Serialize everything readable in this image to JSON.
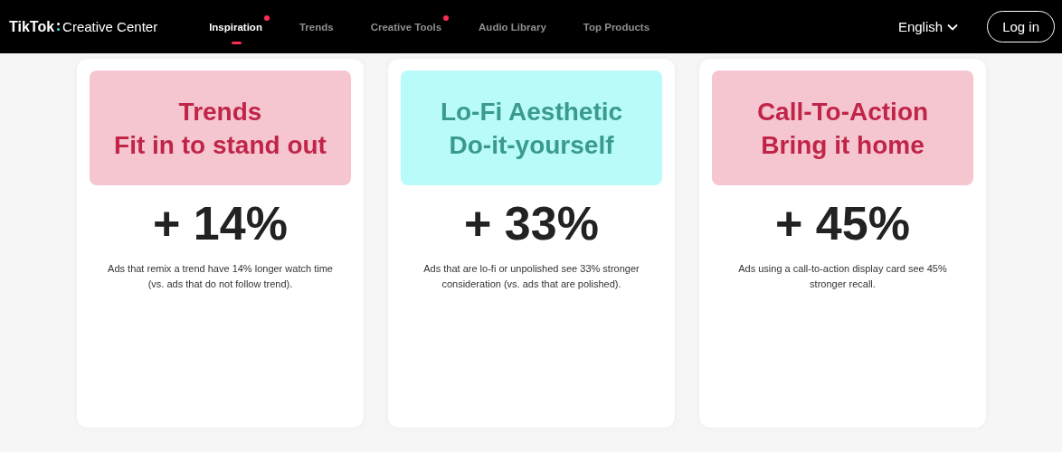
{
  "header": {
    "logo": {
      "brand": "TikTok",
      "product": "Creative Center"
    },
    "nav": [
      {
        "label": "Inspiration",
        "selected": true,
        "dot": true
      },
      {
        "label": "Trends",
        "selected": false,
        "dot": false
      },
      {
        "label": "Creative Tools",
        "selected": false,
        "dot": true
      },
      {
        "label": "Audio Library",
        "selected": false,
        "dot": false
      },
      {
        "label": "Top Products",
        "selected": false,
        "dot": false
      }
    ],
    "language": "English",
    "login": "Log in"
  },
  "cards": [
    {
      "kind": "pink",
      "title": "Trends",
      "subtitle": "Fit in to stand out",
      "stat": "+ 14%",
      "description": "Ads that remix a trend have 14% longer watch time (vs. ads that do not follow trend)."
    },
    {
      "kind": "cyan",
      "title": "Lo-Fi Aesthetic",
      "subtitle": "Do-it-yourself",
      "stat": "+ 33%",
      "description": "Ads that are lo-fi or unpolished see 33% stronger consideration (vs. ads that are polished)."
    },
    {
      "kind": "pink",
      "title": "Call-To-Action",
      "subtitle": "Bring it home",
      "stat": "+ 45%",
      "description": "Ads using a call-to-action display card see 45% stronger recall."
    }
  ]
}
